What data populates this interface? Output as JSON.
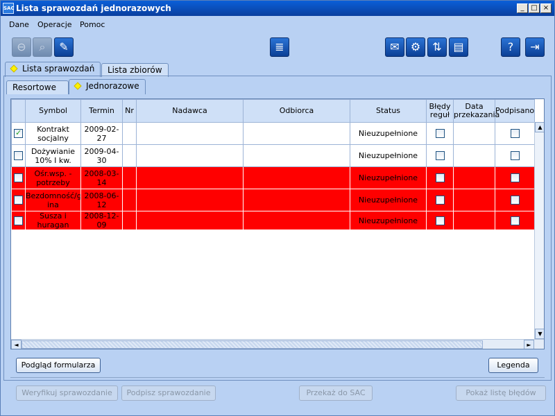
{
  "window": {
    "title": "Lista sprawozdań jednorazowych",
    "app_icon": "SAC",
    "minimize_glyph": "_",
    "maximize_glyph": "□",
    "close_glyph": "×"
  },
  "menu": {
    "items": [
      {
        "label": "Dane"
      },
      {
        "label": "Operacje"
      },
      {
        "label": "Pomoc"
      }
    ]
  },
  "toolbar": {
    "icons": [
      "zoom-out-icon",
      "zoom-icon",
      "pencil-icon",
      "database-icon",
      "envelope-icon",
      "gears-icon",
      "arrows-icon",
      "document-icon",
      "help-icon",
      "exit-icon"
    ],
    "glyphs": {
      "zoom_out": "⊖",
      "zoom": "⌕",
      "edit": "✎",
      "db": "≣",
      "mail": "✉",
      "gears": "⚙",
      "arrows": "⇅",
      "doc": "▤",
      "help": "?",
      "exit": "⇥"
    }
  },
  "tabs_top": [
    {
      "label": "Lista sprawozdań",
      "active": true
    },
    {
      "label": "Lista zbiorów",
      "active": false
    }
  ],
  "tabs_sub": [
    {
      "label": "Resortowe",
      "active": false
    },
    {
      "label": "Jednorazowe",
      "active": true
    }
  ],
  "table": {
    "columns": {
      "symbol": "Symbol",
      "termin": "Termin",
      "nr": "Nr",
      "nadawca": "Nadawca",
      "odbiorca": "Odbiorca",
      "status": "Status",
      "bledy_1": "Błędy",
      "bledy_2": "reguł",
      "data_1": "Data",
      "data_2": "przekazania",
      "podpisano": "Podpisano"
    },
    "rows": [
      {
        "checked": true,
        "symbol_1": "Kontrakt",
        "symbol_2": "socjalny",
        "termin": "2009-02-27",
        "nr": "",
        "nadawca": "",
        "odbiorca": "",
        "status": "Nieuzupełnione",
        "bledy": false,
        "data": "",
        "podpisano": false,
        "highlight": false
      },
      {
        "checked": false,
        "symbol_1": "Dożywianie",
        "symbol_2": "10% I kw.",
        "termin": "2009-04-30",
        "nr": "",
        "nadawca": "",
        "odbiorca": "",
        "status": "Nieuzupełnione",
        "bledy": false,
        "data": "",
        "podpisano": false,
        "highlight": false
      },
      {
        "checked": false,
        "symbol_1": "Ośr.wsp. -",
        "symbol_2": "potrzeby",
        "termin": "2008-03-14",
        "nr": "",
        "nadawca": "",
        "odbiorca": "",
        "status": "Nieuzupełnione",
        "bledy": false,
        "data": "",
        "podpisano": false,
        "highlight": true
      },
      {
        "checked": false,
        "symbol_1": "Bezdomność/gm",
        "symbol_2": "ina",
        "termin": "2008-06-12",
        "nr": "",
        "nadawca": "",
        "odbiorca": "",
        "status": "Nieuzupełnione",
        "bledy": false,
        "data": "",
        "podpisano": false,
        "highlight": true
      },
      {
        "checked": false,
        "symbol_1": "Susza i huragan",
        "symbol_2": "",
        "termin": "2008-12-09",
        "nr": "",
        "nadawca": "",
        "odbiorca": "",
        "status": "Nieuzupełnione",
        "bledy": false,
        "data": "",
        "podpisano": false,
        "highlight": true
      }
    ]
  },
  "colors": {
    "highlight_row": "#ff0000",
    "window_bg": "#b9d1f3",
    "title_bar": "#0a4fc0"
  },
  "buttons": {
    "preview": "Podgląd formularza",
    "legend": "Legenda",
    "verify": "Weryfikuj sprawozdanie",
    "sign": "Podpisz sprawozdanie",
    "send": "Przekaż do SAC",
    "errors": "Pokaż listę błędów"
  },
  "scroll_glyphs": {
    "up": "▲",
    "down": "▼",
    "left": "◄",
    "right": "►"
  }
}
